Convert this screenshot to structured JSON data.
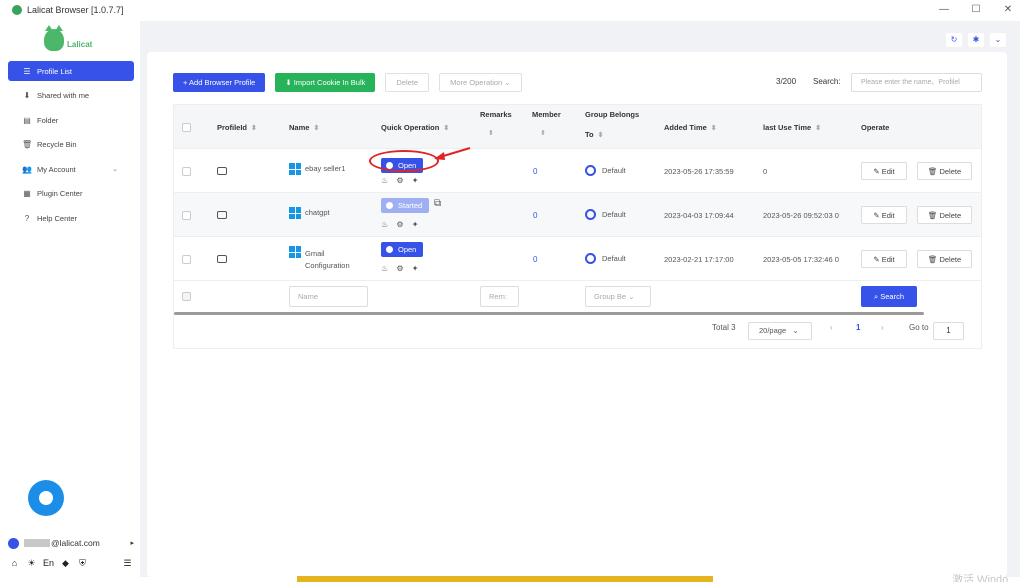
{
  "window": {
    "title": "Lalicat Browser  [1.0.7.7]",
    "controls": [
      "—",
      "☐",
      "✕"
    ]
  },
  "brand": {
    "name": "Lalicat"
  },
  "sidebar": {
    "items": [
      {
        "icon": "list-icon",
        "glyph": "☰",
        "label": "Profile List",
        "active": true
      },
      {
        "icon": "download-icon",
        "glyph": "⬇",
        "label": "Shared with me"
      },
      {
        "icon": "folder-icon",
        "glyph": "▤",
        "label": "Folder"
      },
      {
        "icon": "trash-icon",
        "glyph": "🗑",
        "label": "Recycle Bin"
      },
      {
        "icon": "users-icon",
        "glyph": "👥",
        "label": "My Account",
        "caret": "⌄"
      },
      {
        "icon": "grid-icon",
        "glyph": "▦",
        "label": "Plugin Center"
      },
      {
        "icon": "help-icon",
        "glyph": "?",
        "label": "Help Center"
      }
    ],
    "user_email": "@lalicat.com",
    "user_arrow": "▸",
    "bottom_icons": [
      {
        "icon": "home-icon",
        "glyph": "⌂"
      },
      {
        "icon": "sun-icon",
        "glyph": "☀"
      },
      {
        "icon": "language-icon",
        "glyph": "En"
      },
      {
        "icon": "tag-icon",
        "glyph": "◆"
      },
      {
        "icon": "shield-icon",
        "glyph": "⛨"
      }
    ],
    "menu_glyph": "☰"
  },
  "top_icons": [
    {
      "icon": "refresh-icon",
      "glyph": "↻"
    },
    {
      "icon": "gear-icon",
      "glyph": "✱"
    },
    {
      "icon": "chevron-down-icon",
      "glyph": "⌄"
    }
  ],
  "toolbar": {
    "add_label": "+ Add Browser Profile",
    "import_label": "⬇  Import Cookie In Bulk",
    "delete_label": "Delete",
    "more_label": "More Operation  ⌄",
    "count": "3/200",
    "search_label": "Search:",
    "search_placeholder": "Please enter the name、Profilel"
  },
  "table": {
    "headers": {
      "profile_id": "ProfileId",
      "name": "Name",
      "quick_operation": "Quick Operation",
      "remarks": "Remarks",
      "member": "Member",
      "group_line1": "Group Belongs",
      "group_line2": "To",
      "added_time": "Added Time",
      "last_use_time": "last Use Time",
      "operate": "Operate"
    },
    "sort_glyph": "⬍",
    "rows": [
      {
        "name1": "ebay seller1",
        "name2": "",
        "quick": "Open",
        "member": "0",
        "group": "Default",
        "added": "2023-05-26 17:35:59",
        "last_use": "0",
        "started": false
      },
      {
        "name1": "chatgpt",
        "name2": "",
        "quick": "Started",
        "member": "0",
        "group": "Default",
        "added": "2023-04-03 17:09:44",
        "last_use": "2023-05-26 09:52:03 0",
        "started": true
      },
      {
        "name1": "Gmail",
        "name2": "Configuration",
        "quick": "Open",
        "member": "0",
        "group": "Default",
        "added": "2023-02-21 17:17:00",
        "last_use": "2023-05-05 17:32:46 0",
        "started": false
      }
    ],
    "quick_icons": "♨ ⚙ ✦",
    "edit_label": "✎ Edit",
    "delete_label": "🗑 Delete",
    "filters": {
      "name_placeholder": "Name",
      "remarks_placeholder": "Rem:",
      "group_placeholder": "Group Be",
      "group_caret": "⌄",
      "search_label": "⌕ Search"
    }
  },
  "pagination": {
    "total": "Total 3",
    "page_size": "20/page",
    "page_size_caret": "⌄",
    "prev": "‹",
    "current": "1",
    "next": "›",
    "goto_label": "Go to",
    "goto_value": "1"
  },
  "watermark": "激活 Windo"
}
